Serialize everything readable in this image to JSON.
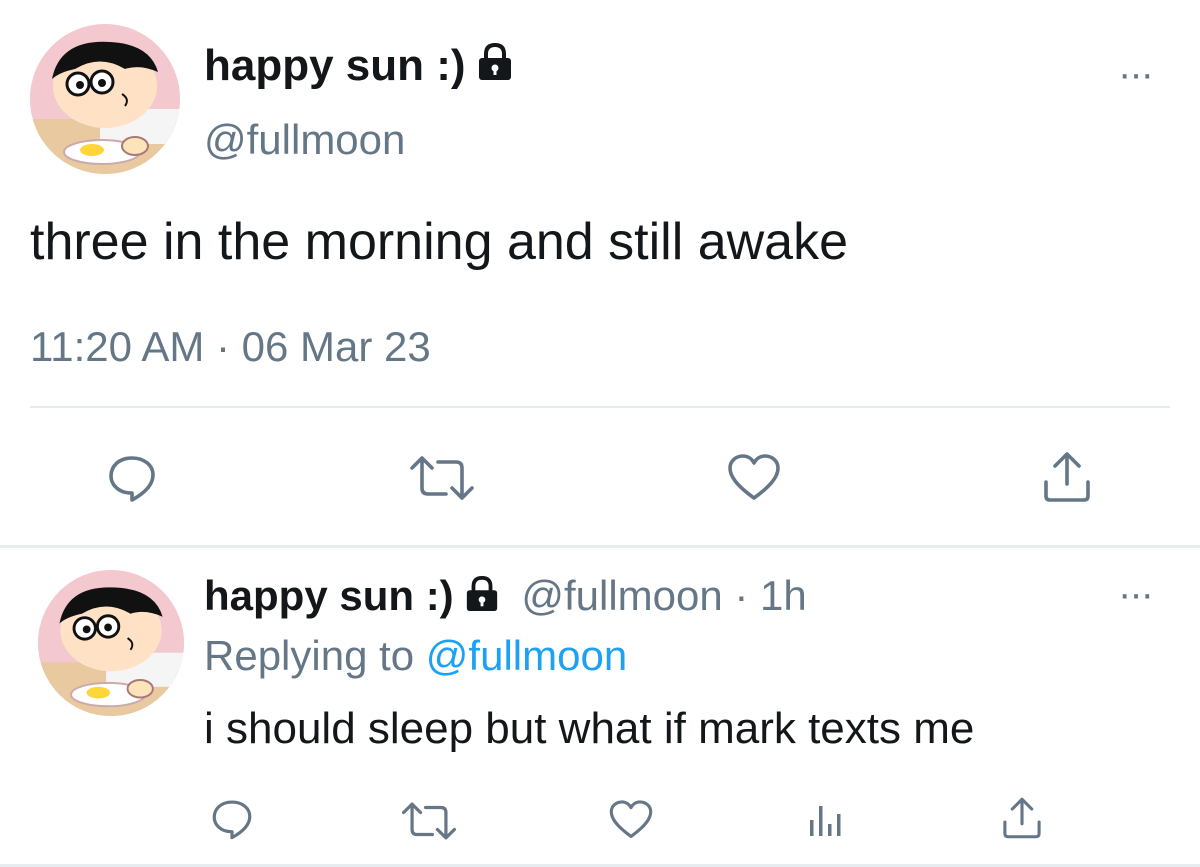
{
  "main_tweet": {
    "display_name": "happy sun :)",
    "handle": "@fullmoon",
    "text": "three in the morning and still awake",
    "timestamp": "11:20 AM · 06 Mar 23",
    "more_label": "···"
  },
  "reply_tweet": {
    "display_name": "happy sun :)",
    "handle_time": "@fullmoon · 1h",
    "replying_prefix": "Replying to",
    "replying_mention": "@fullmoon",
    "text": "i should sleep but what if mark texts me",
    "more_label": "···"
  },
  "icons": {
    "protected": "lock-icon",
    "reply": "reply-icon",
    "retweet": "retweet-icon",
    "like": "heart-icon",
    "share": "share-icon",
    "analytics": "analytics-icon"
  },
  "colors": {
    "text": "#14171a",
    "secondary": "#657786",
    "link": "#1da1f2",
    "divider": "#e6ecf0"
  }
}
